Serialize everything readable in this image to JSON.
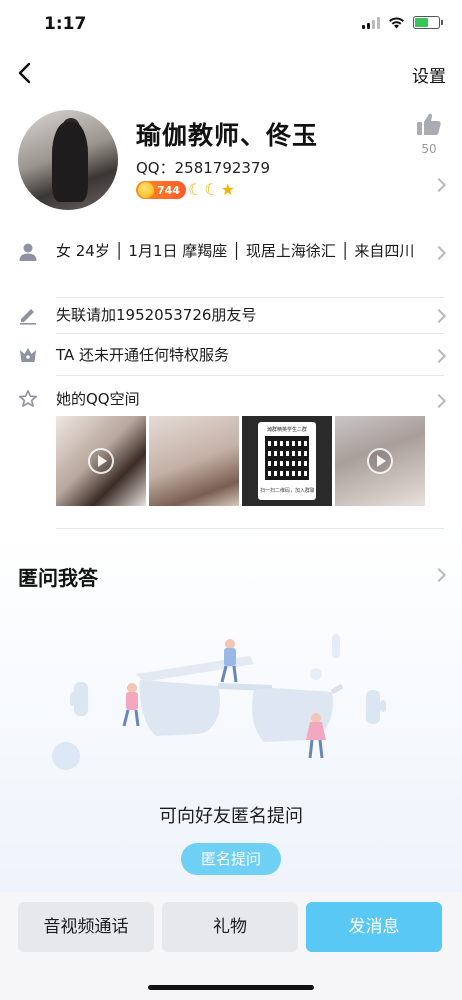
{
  "status_bar": {
    "time": "1:17"
  },
  "nav": {
    "back_icon": "chevron-left-icon",
    "settings_label": "设置"
  },
  "profile": {
    "name": "瑜伽教师、佟玉",
    "qq_label": "QQ：2581792379",
    "level_number": "744",
    "level_icons": [
      "moon-icon",
      "moon-icon",
      "star-icon"
    ],
    "like_count": "50"
  },
  "info_rows": {
    "basic": "女 24岁 │ 1月1日 摩羯座 │ 现居上海徐汇 │ 来自四川",
    "signature": "失联请加1952053726朋友号",
    "privilege": "TA 还未开通任何特权服务",
    "qzone": "她的QQ空间"
  },
  "qzone_photos": {
    "qr_title": "瀚群精英学生二群",
    "qr_footer": "扫一扫二维码，加入群聊"
  },
  "qa": {
    "title": "匿问我答",
    "prompt": "可向好友匿名提问",
    "button_label": "匿名提问"
  },
  "bottom_actions": {
    "call_label": "音视频通话",
    "gift_label": "礼物",
    "message_label": "发消息"
  },
  "colors": {
    "accent": "#59c8f4",
    "qa_button": "#6fd0f5",
    "level_badge": "#ff6a26",
    "level_icon": "#f5b400"
  }
}
